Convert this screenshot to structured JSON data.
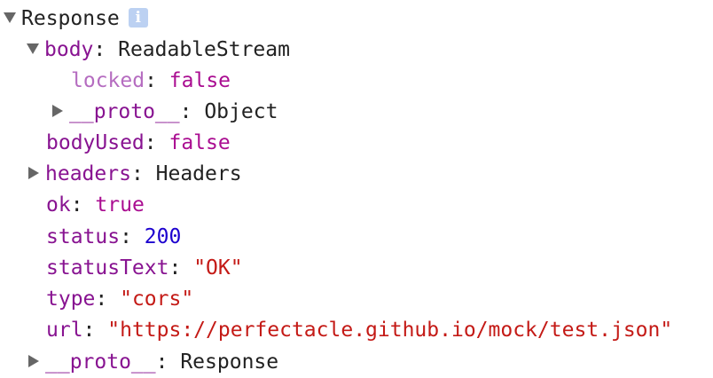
{
  "response": {
    "label": "Response",
    "info_glyph": "i",
    "body": {
      "key": "body",
      "value": "ReadableStream",
      "locked": {
        "key": "locked",
        "value": "false"
      },
      "proto": {
        "key": "__proto__",
        "value": "Object"
      }
    },
    "bodyUsed": {
      "key": "bodyUsed",
      "value": "false"
    },
    "headers": {
      "key": "headers",
      "value": "Headers"
    },
    "ok": {
      "key": "ok",
      "value": "true"
    },
    "status": {
      "key": "status",
      "value": "200"
    },
    "statusText": {
      "key": "statusText",
      "value": "\"OK\""
    },
    "type": {
      "key": "type",
      "value": "\"cors\""
    },
    "url": {
      "key": "url",
      "value": "\"https://perfectacle.github.io/mock/test.json\""
    },
    "proto": {
      "key": "__proto__",
      "value": "Response"
    }
  },
  "colors": {
    "key": "#881391",
    "key_dim": "#b56cc0",
    "boolean": "#aa0d91",
    "number": "#1c00cf",
    "string": "#c41a16",
    "info_badge": "#bcd1f2",
    "disclosure": "#666666"
  },
  "icons": {
    "expanded": "triangle-down-icon",
    "collapsed": "triangle-right-icon",
    "info": "info-icon"
  }
}
